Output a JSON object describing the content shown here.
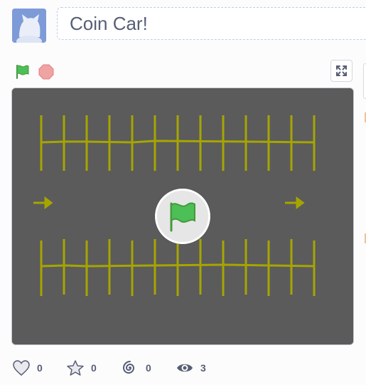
{
  "project": {
    "title": "Coin Car!"
  },
  "author": {
    "avatar_icon": "cat-avatar-icon"
  },
  "controls": {
    "green_flag_icon": "green-flag-icon",
    "stop_icon": "stop-sign-icon",
    "fullscreen_icon": "fullscreen-icon"
  },
  "stage": {
    "background_color": "#5b5b5b",
    "line_color": "#a6a500",
    "overlay_icon": "green-flag-icon"
  },
  "stats": {
    "loves": "0",
    "favorites": "0",
    "remixes": "0",
    "views": "3"
  },
  "colors": {
    "text": "#575e75",
    "flag_green": "#4cbf56",
    "stop_red": "#ec9c9c"
  }
}
